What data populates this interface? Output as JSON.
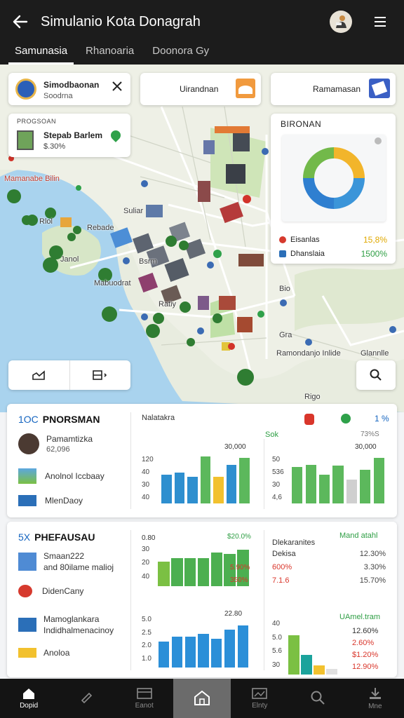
{
  "app": {
    "title": "Simulanio Kota Donagrah"
  },
  "tabs": [
    {
      "label": "Samunasia",
      "active": true
    },
    {
      "label": "Rhanoaria",
      "active": false
    },
    {
      "label": "Doonora Gy",
      "active": false
    }
  ],
  "map": {
    "search_card": {
      "title": "Simodbaonan",
      "subtitle": "Soodrna"
    },
    "chip_1": "Uirandnan",
    "chip_2": "Ramamasan",
    "info_card": {
      "header": "PROGSOAN",
      "title": "Stepab Barlem",
      "value": "$.30%"
    },
    "donut_card": {
      "title": "BIRONAN",
      "legend": [
        {
          "label": "Eisanlas",
          "value": "15,8%",
          "value_color": "#e0a800"
        },
        {
          "label": "Dhanslaia",
          "value": "1500%",
          "value_color": "#2e9e44"
        }
      ],
      "slices": [
        {
          "value": 25,
          "color": "#f2b52b"
        },
        {
          "value": 25,
          "color": "#3b95d9"
        },
        {
          "value": 25,
          "color": "#2f7fd0"
        },
        {
          "value": 25,
          "color": "#72b94a"
        }
      ]
    },
    "labels": {
      "l1": "Mamanabe Bilin",
      "l2": "Rlol",
      "l3": "Rebade",
      "l4": "Suliar",
      "l5": "Janol",
      "l6": "Mabuodrat",
      "l7": "Bsrm",
      "l8": "Ratiy",
      "l9": "Bio",
      "l10": "Gra",
      "l11": "Ramondanjo Inlide",
      "l12": "Glannlle",
      "l13": "Rigo"
    }
  },
  "panel1": {
    "title": "PNORSMAN",
    "title_icon": "1OC",
    "rows": [
      {
        "label": "Pamamtizka",
        "sub": "62,096"
      },
      {
        "label": "Anolnol Iccbaay"
      },
      {
        "label": "MlenDaoy"
      }
    ],
    "mid": {
      "title": "Nalatakra",
      "ymax_label": "30,000",
      "yticks": [
        "120",
        "40",
        "30",
        "40"
      ],
      "bars": [
        {
          "value": 55,
          "color": "#2e8fcf"
        },
        {
          "value": 60,
          "color": "#2e8fcf"
        },
        {
          "value": 52,
          "color": "#2e8fcf"
        },
        {
          "value": 90,
          "color": "#5cb85c"
        },
        {
          "value": 52,
          "color": "#f2c12e"
        },
        {
          "value": 75,
          "color": "#2e8fcf"
        },
        {
          "value": 88,
          "color": "#5cb85c"
        }
      ]
    },
    "right": {
      "title": "Sok",
      "top_value": "1 %",
      "percent_label": "73%S",
      "ymax_label": "30,000",
      "yticks": [
        "50",
        "536",
        "30",
        "4,6"
      ],
      "bars": [
        {
          "value": 70,
          "color": "#5cb85c"
        },
        {
          "value": 74,
          "color": "#5cb85c"
        },
        {
          "value": 55,
          "color": "#5cb85c"
        },
        {
          "value": 73,
          "color": "#5cb85c"
        },
        {
          "value": 46,
          "color": "#cfcfcf"
        },
        {
          "value": 65,
          "color": "#5cb85c"
        },
        {
          "value": 88,
          "color": "#5cb85c"
        }
      ]
    }
  },
  "panel2": {
    "title": "PHEFAUSAU",
    "title_icon": "5X",
    "rows": [
      {
        "label": "Smaan222",
        "sub": "and 80ilame malioj"
      },
      {
        "label": "DidenCany"
      },
      {
        "label": "Mamoglankara",
        "sub": "Indidhalmenacinoy"
      },
      {
        "label": "Anoloa"
      }
    ],
    "chart1": {
      "label_left": "0.80",
      "label_right": "$20.0%",
      "yticks": [
        "30",
        "20",
        "40"
      ],
      "right_vals": [
        "5.90%",
        "350%"
      ],
      "bars": [
        {
          "value": 55,
          "color": "#7bc043"
        },
        {
          "value": 62,
          "color": "#4caf50"
        },
        {
          "value": 62,
          "color": "#4caf50"
        },
        {
          "value": 62,
          "color": "#4caf50"
        },
        {
          "value": 75,
          "color": "#4caf50"
        },
        {
          "value": 72,
          "color": "#4caf50"
        },
        {
          "value": 82,
          "color": "#4caf50"
        }
      ]
    },
    "chart2": {
      "label_right": "22.80",
      "yticks": [
        "5.0",
        "2.5",
        "2.0",
        "1.0"
      ],
      "bars": [
        {
          "value": 55,
          "color": "#2b8fd8"
        },
        {
          "value": 65,
          "color": "#2b8fd8"
        },
        {
          "value": 65,
          "color": "#2b8fd8"
        },
        {
          "value": 70,
          "color": "#2b8fd8"
        },
        {
          "value": 60,
          "color": "#2b8fd8"
        },
        {
          "value": 80,
          "color": "#2b8fd8"
        },
        {
          "value": 88,
          "color": "#2b8fd8"
        }
      ]
    },
    "stats": {
      "title": "Dlekaranites",
      "title_right": "Mand atahl",
      "items": [
        {
          "label": "Dekisa",
          "value": "12.30%",
          "label_color": "#333"
        },
        {
          "label": "600%",
          "value": "3.30%",
          "label_color": "#d9362b"
        },
        {
          "label": "7.1.6",
          "value": "15.70%",
          "label_color": "#d9362b"
        }
      ]
    },
    "chart3": {
      "title_right": "UAmel.tram",
      "yticks": [
        "40",
        "5.0",
        "5.6",
        "30"
      ],
      "right_vals": [
        "12.60%",
        "2.60%",
        "$1.20%",
        "12.90%"
      ],
      "bars": [
        {
          "value": 80,
          "color": "#7bc043"
        },
        {
          "value": 40,
          "color": "#1ba39c"
        },
        {
          "value": 18,
          "color": "#f2c12e"
        },
        {
          "value": 12,
          "color": "#e0e0e0"
        }
      ]
    }
  },
  "nav": [
    {
      "label": "Dopid",
      "icon": "home-icon"
    },
    {
      "label": "",
      "icon": "tag-icon"
    },
    {
      "label": "Eanot",
      "icon": "board-icon"
    },
    {
      "label": "",
      "icon": "house-icon",
      "active": true
    },
    {
      "label": "Elnty",
      "icon": "gallery-icon"
    },
    {
      "label": "",
      "icon": "search-icon"
    },
    {
      "label": "Mne",
      "icon": "download-icon"
    }
  ]
}
